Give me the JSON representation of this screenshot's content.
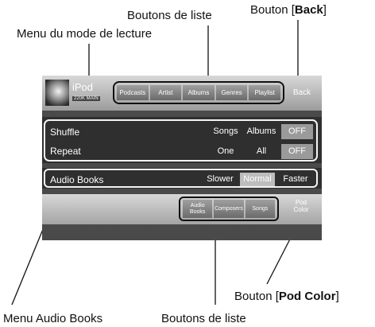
{
  "annotations": {
    "top_list_buttons": "Boutons de liste",
    "back_button_prefix": "Bouton [",
    "back_button_bold": "Back",
    "back_button_suffix": "]",
    "playback_mode_menu": "Menu du mode de lecture",
    "pod_color_prefix": "Bouton [",
    "pod_color_bold": "Pod Color",
    "pod_color_suffix": "]",
    "audio_books_menu": "Menu Audio Books",
    "bottom_list_buttons": "Boutons de liste"
  },
  "header": {
    "title": "iPod",
    "subtitle": "220K MAIN",
    "list_buttons": [
      "Podcasts",
      "Artist",
      "Albums",
      "Genres",
      "Playlist"
    ],
    "back_label": "Back"
  },
  "playback_mode": {
    "rows": [
      {
        "label": "Shuffle",
        "options": [
          "Songs",
          "Albums",
          "OFF"
        ],
        "selected": "OFF"
      },
      {
        "label": "Repeat",
        "options": [
          "One",
          "All",
          "OFF"
        ],
        "selected": "OFF"
      }
    ]
  },
  "audio_books": {
    "label": "Audio Books",
    "options": [
      "Slower",
      "Normal",
      "Faster"
    ],
    "selected": "Normal"
  },
  "bottom_bar": {
    "list_buttons": [
      "Audio\nBooks",
      "Composers",
      "Songs"
    ],
    "pod_color_label": "Pod\nColor"
  }
}
